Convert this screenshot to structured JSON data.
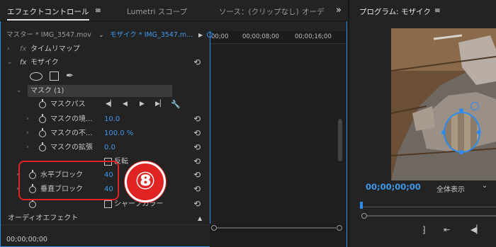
{
  "tabs": {
    "effect_controls": "エフェクトコントロール",
    "menu": "≡",
    "lumetri": "Lumetri スコープ",
    "source": "ソース：(クリップなし)",
    "audio": "オーデ",
    "more": "»"
  },
  "header": {
    "master": "マスター * IMG_3547.mov",
    "clip": "モザイク * IMG_3547.m...",
    "chevron": "⌄",
    "play": "▶"
  },
  "ruler": {
    "t0": "00;00",
    "t1": "00;00;08;00",
    "t2": "00;00;16;00"
  },
  "effects": {
    "time_remap": "タイムリマップ",
    "mosaic": "モザイク",
    "mask_group": "マスク (1)",
    "mask_path": "マスクパス",
    "mask_feather": {
      "label": "マスクの境...",
      "value": "10.0"
    },
    "mask_opacity": {
      "label": "マスクの不...",
      "value": "100.0 %"
    },
    "mask_expansion": {
      "label": "マスクの拡張",
      "value": "0.0"
    },
    "invert": "反転",
    "horizontal_blocks": {
      "label": "水平ブロック",
      "value": "40"
    },
    "vertical_blocks": {
      "label": "垂直ブロック",
      "value": "40"
    },
    "sharp_colors": "シャープカラー",
    "audio_effects": "オーディオエフェクト"
  },
  "footer": {
    "timecode": "00;00;00;00"
  },
  "program": {
    "title": "プログラム: モザイク",
    "menu": "≡",
    "timecode": "00;00;00;00",
    "zoom": "全体表示",
    "zoom_chevron": "⌄"
  },
  "annotation": {
    "number": "⑧",
    "color": "#e02424"
  },
  "colors": {
    "accent": "#2d8ceb",
    "value": "#3f97ea"
  }
}
